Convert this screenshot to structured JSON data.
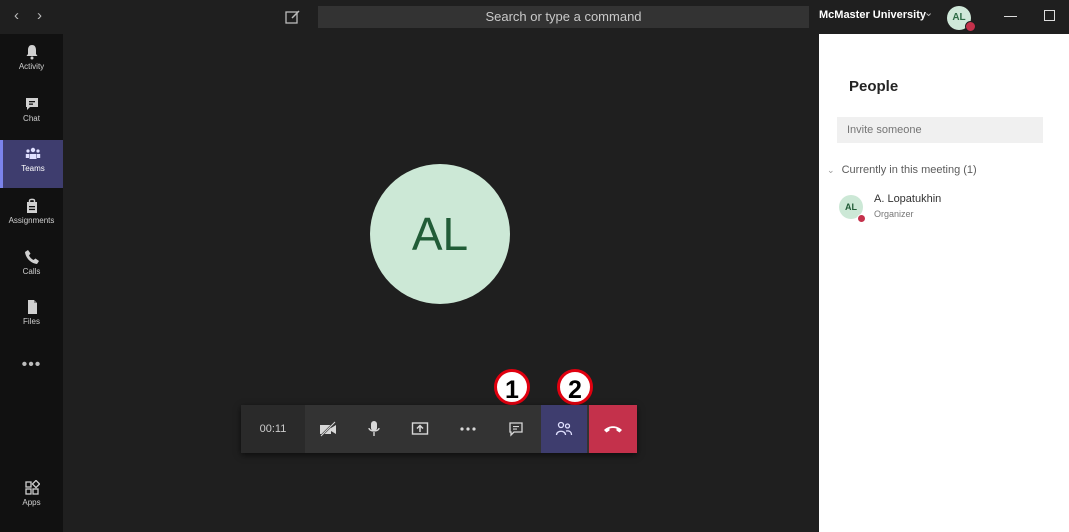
{
  "titlebar": {
    "search_placeholder": "Search or type a command",
    "org_name": "McMaster University",
    "user_initials": "AL"
  },
  "rail": {
    "items": [
      {
        "label": "Activity",
        "icon": "bell-icon"
      },
      {
        "label": "Chat",
        "icon": "chat-icon"
      },
      {
        "label": "Teams",
        "icon": "teams-icon"
      },
      {
        "label": "Assignments",
        "icon": "assignments-icon"
      },
      {
        "label": "Calls",
        "icon": "phone-icon"
      },
      {
        "label": "Files",
        "icon": "file-icon"
      },
      {
        "label": "Apps",
        "icon": "apps-icon"
      }
    ],
    "more": "•••",
    "active": "Teams"
  },
  "stage": {
    "avatar_initials": "AL"
  },
  "callbar": {
    "timer": "00:11",
    "markers": [
      "1",
      "2"
    ]
  },
  "panel": {
    "title": "People",
    "invite_placeholder": "Invite someone",
    "section": "Currently in this meeting (1)",
    "participants": [
      {
        "initials": "AL",
        "name": "A. Lopatukhin",
        "role": "Organizer"
      }
    ]
  },
  "colors": {
    "accent": "#7b83eb",
    "active_bg": "#3e3d6e",
    "hangup": "#c4314b",
    "marker": "#e0000f"
  }
}
